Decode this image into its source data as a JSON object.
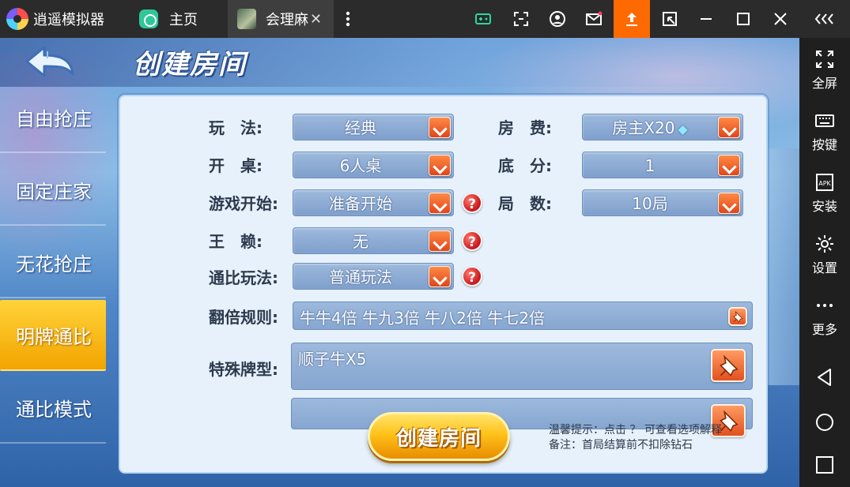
{
  "titlebar": {
    "app_name": "逍遥模拟器",
    "home_tab": "主页",
    "game_tab": "会理麻",
    "tab_close": "✕",
    "accent": "#ff6a00"
  },
  "sidebar": {
    "items": [
      {
        "label": "全屏",
        "icon": "fullscreen-icon"
      },
      {
        "label": "按键",
        "icon": "keyboard-icon"
      },
      {
        "label": "安装",
        "icon": "apk-icon"
      },
      {
        "label": "设置",
        "icon": "gear-icon"
      },
      {
        "label": "更多",
        "icon": "more-icon"
      }
    ],
    "apk_text": "APK"
  },
  "game": {
    "title": "创建房间",
    "modes": [
      "自由抢庄",
      "固定庄家",
      "无花抢庄",
      "明牌通比",
      "通比模式"
    ],
    "active_mode": "明牌通比",
    "fields": {
      "play_label": "玩　法:",
      "play_value": "经典",
      "fee_label": "房　费:",
      "fee_value": "房主X20",
      "table_label": "开　桌:",
      "table_value": "6人桌",
      "base_label": "底　分:",
      "base_value": "1",
      "start_label": "游戏开始:",
      "start_value": "准备开始",
      "rounds_label": "局　数:",
      "rounds_value": "10局",
      "joker_label": "王　赖:",
      "joker_value": "无",
      "tongbi_label": "通比玩法:",
      "tongbi_value": "普通玩法",
      "multiplier_label": "翻倍规则:",
      "multiplier_value": "牛牛4倍 牛九3倍 牛八2倍 牛七2倍",
      "special_label": "特殊牌型:",
      "special_value": "顺子牛X5"
    },
    "help_glyph": "?",
    "create_button": "创建房间",
    "tip_line1": "温馨提示：点击 ？ 可查看选项解释",
    "tip_line2": "备注：首局结算前不扣除钻石"
  }
}
